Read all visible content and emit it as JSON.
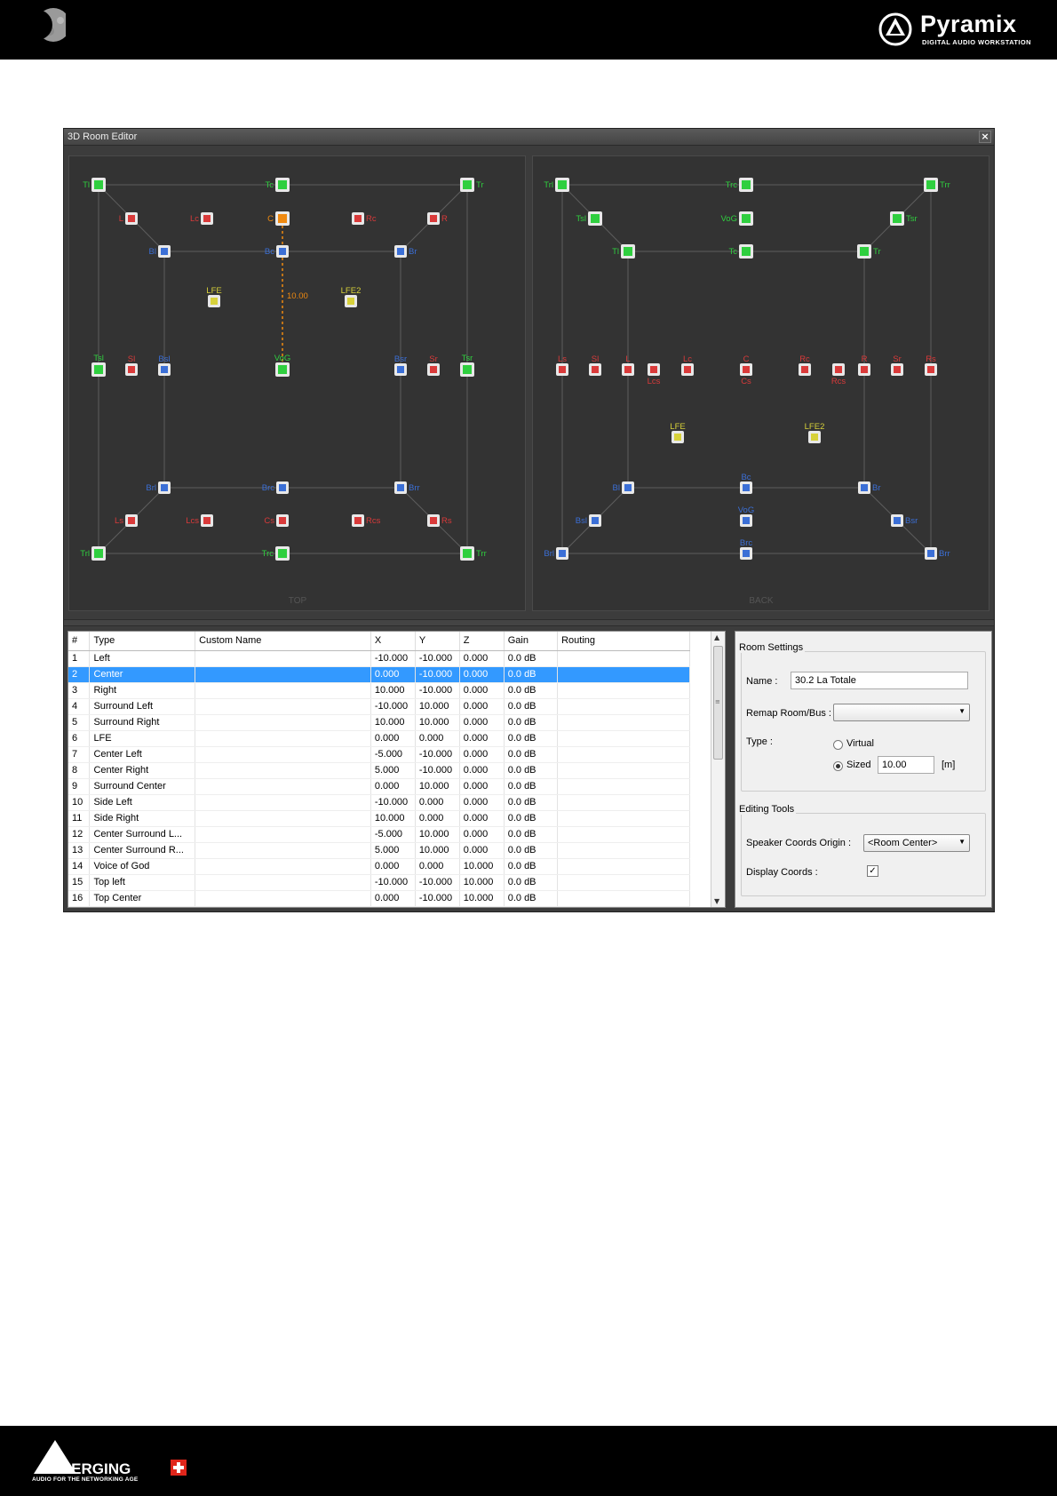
{
  "header": {
    "brand_title": "Pyramix",
    "brand_subtitle": "DIGITAL AUDIO WORKSTATION",
    "moon_icon": "moon-icon",
    "logo_icon": "pyramix-triangle-logo"
  },
  "footer": {
    "logo_text": "MERGING",
    "tagline": "AUDIO FOR THE NETWORKING AGE",
    "logo_icon": "merging-plus-logo"
  },
  "window": {
    "title": "3D Room Editor",
    "close_icon": "close-icon"
  },
  "views": {
    "top_label": "TOP",
    "back_label": "BACK",
    "top_measure_label": "10.00",
    "colors": {
      "green": "#2fcf3f",
      "red": "#d93a3a",
      "blue": "#3b6fd6",
      "orange": "#f08a10",
      "yellow": "#d7d13a"
    },
    "top_speakers": [
      {
        "label": "Tl",
        "color": "green"
      },
      {
        "label": "Tc",
        "color": "green"
      },
      {
        "label": "Tr",
        "color": "green"
      },
      {
        "label": "L",
        "color": "red"
      },
      {
        "label": "Lc",
        "color": "red"
      },
      {
        "label": "C",
        "color": "orange"
      },
      {
        "label": "Rc",
        "color": "red"
      },
      {
        "label": "R",
        "color": "red"
      },
      {
        "label": "Bl",
        "color": "blue"
      },
      {
        "label": "Bc",
        "color": "blue"
      },
      {
        "label": "Br",
        "color": "blue"
      },
      {
        "label": "LFE",
        "color": "yellow"
      },
      {
        "label": "LFE2",
        "color": "yellow"
      },
      {
        "label": "Tsl",
        "color": "green"
      },
      {
        "label": "Sl",
        "color": "red"
      },
      {
        "label": "Bsl",
        "color": "blue"
      },
      {
        "label": "VoG",
        "color": "green"
      },
      {
        "label": "Bsr",
        "color": "blue"
      },
      {
        "label": "Sr",
        "color": "red"
      },
      {
        "label": "Tsr",
        "color": "green"
      },
      {
        "label": "Brl",
        "color": "blue"
      },
      {
        "label": "Brc",
        "color": "blue"
      },
      {
        "label": "Brr",
        "color": "blue"
      },
      {
        "label": "Ls",
        "color": "red"
      },
      {
        "label": "Lcs",
        "color": "red"
      },
      {
        "label": "Cs",
        "color": "red"
      },
      {
        "label": "Rcs",
        "color": "red"
      },
      {
        "label": "Rs",
        "color": "red"
      },
      {
        "label": "Trl",
        "color": "green"
      },
      {
        "label": "Trc",
        "color": "green"
      },
      {
        "label": "Trr",
        "color": "green"
      }
    ],
    "back_speakers": [
      {
        "label": "Trl",
        "color": "green"
      },
      {
        "label": "Trc",
        "color": "green"
      },
      {
        "label": "Trr",
        "color": "green"
      },
      {
        "label": "Tsl",
        "color": "green"
      },
      {
        "label": "VoG",
        "color": "green"
      },
      {
        "label": "Tsr",
        "color": "green"
      },
      {
        "label": "Tl",
        "color": "green"
      },
      {
        "label": "Tc",
        "color": "green"
      },
      {
        "label": "Tr",
        "color": "green"
      },
      {
        "label": "Ls",
        "color": "red"
      },
      {
        "label": "Sl",
        "color": "red"
      },
      {
        "label": "L",
        "color": "red"
      },
      {
        "label": "Lcs",
        "color": "red"
      },
      {
        "label": "Lc",
        "color": "red"
      },
      {
        "label": "C",
        "color": "red"
      },
      {
        "label": "Cs",
        "color": "red"
      },
      {
        "label": "Rc",
        "color": "red"
      },
      {
        "label": "Rcs",
        "color": "red"
      },
      {
        "label": "R",
        "color": "red"
      },
      {
        "label": "Sr",
        "color": "red"
      },
      {
        "label": "Rs",
        "color": "red"
      },
      {
        "label": "LFE",
        "color": "yellow"
      },
      {
        "label": "LFE2",
        "color": "yellow"
      },
      {
        "label": "Bl",
        "color": "blue"
      },
      {
        "label": "Bc",
        "color": "blue"
      },
      {
        "label": "Br",
        "color": "blue"
      },
      {
        "label": "Bsl",
        "color": "blue"
      },
      {
        "label": "VoG",
        "color": "blue"
      },
      {
        "label": "Bsr",
        "color": "blue"
      },
      {
        "label": "Brl",
        "color": "blue"
      },
      {
        "label": "Brc",
        "color": "blue"
      },
      {
        "label": "Brr",
        "color": "blue"
      }
    ]
  },
  "table": {
    "headers": [
      "#",
      "Type",
      "Custom Name",
      "X",
      "Y",
      "Z",
      "Gain",
      "Routing"
    ],
    "selected_index": 1,
    "rows": [
      [
        "1",
        "Left",
        "",
        "-10.000",
        "-10.000",
        "0.000",
        "0.0 dB",
        ""
      ],
      [
        "2",
        "Center",
        "",
        "0.000",
        "-10.000",
        "0.000",
        "0.0 dB",
        ""
      ],
      [
        "3",
        "Right",
        "",
        "10.000",
        "-10.000",
        "0.000",
        "0.0 dB",
        ""
      ],
      [
        "4",
        "Surround Left",
        "",
        "-10.000",
        "10.000",
        "0.000",
        "0.0 dB",
        ""
      ],
      [
        "5",
        "Surround Right",
        "",
        "10.000",
        "10.000",
        "0.000",
        "0.0 dB",
        ""
      ],
      [
        "6",
        "LFE",
        "",
        "0.000",
        "0.000",
        "0.000",
        "0.0 dB",
        ""
      ],
      [
        "7",
        "Center Left",
        "",
        "-5.000",
        "-10.000",
        "0.000",
        "0.0 dB",
        ""
      ],
      [
        "8",
        "Center Right",
        "",
        "5.000",
        "-10.000",
        "0.000",
        "0.0 dB",
        ""
      ],
      [
        "9",
        "Surround Center",
        "",
        "0.000",
        "10.000",
        "0.000",
        "0.0 dB",
        ""
      ],
      [
        "10",
        "Side Left",
        "",
        "-10.000",
        "0.000",
        "0.000",
        "0.0 dB",
        ""
      ],
      [
        "11",
        "Side Right",
        "",
        "10.000",
        "0.000",
        "0.000",
        "0.0 dB",
        ""
      ],
      [
        "12",
        "Center Surround L...",
        "",
        "-5.000",
        "10.000",
        "0.000",
        "0.0 dB",
        ""
      ],
      [
        "13",
        "Center Surround R...",
        "",
        "5.000",
        "10.000",
        "0.000",
        "0.0 dB",
        ""
      ],
      [
        "14",
        "Voice of God",
        "",
        "0.000",
        "0.000",
        "10.000",
        "0.0 dB",
        ""
      ],
      [
        "15",
        "Top left",
        "",
        "-10.000",
        "-10.000",
        "10.000",
        "0.0 dB",
        ""
      ],
      [
        "16",
        "Top Center",
        "",
        "0.000",
        "-10.000",
        "10.000",
        "0.0 dB",
        ""
      ]
    ]
  },
  "settings": {
    "room_group_title": "Room Settings",
    "name_label": "Name :",
    "name_value": "30.2 La Totale",
    "remap_label": "Remap Room/Bus :",
    "remap_value": "",
    "type_label": "Type :",
    "virtual_label": "Virtual",
    "sized_label": "Sized",
    "sized_selected": true,
    "size_value": "10.00",
    "size_unit": "[m]",
    "tools_group_title": "Editing Tools",
    "origin_label": "Speaker Coords Origin :",
    "origin_value": "<Room Center>",
    "display_coords_label": "Display Coords :",
    "display_coords_checked": true
  }
}
